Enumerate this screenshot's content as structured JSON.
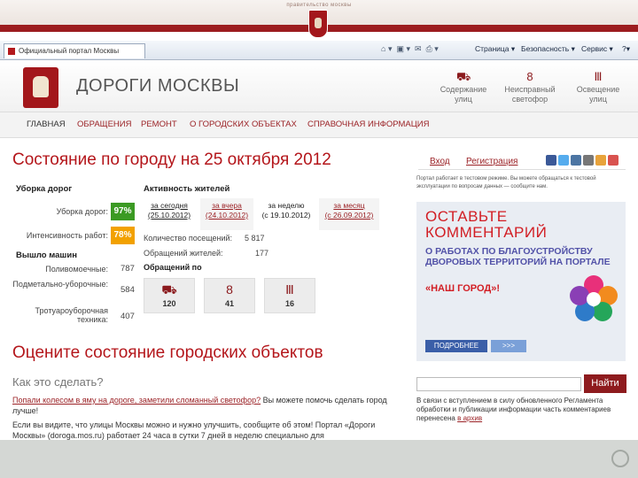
{
  "gov_banner": {
    "label": "правительство москвы"
  },
  "browser": {
    "tab_title": "Официальный портал Москвы",
    "menu": [
      "Страница ▾",
      "Безопасность ▾",
      "Сервис ▾",
      "?▾"
    ],
    "toolbar_icons": [
      "home-icon",
      "feeds-icon",
      "mail-icon",
      "print-icon"
    ]
  },
  "site": {
    "title": "ДОРОГИ МОСКВЫ",
    "header_links": [
      {
        "line1": "Содержание",
        "line2": "улиц",
        "icon": "truck-icon"
      },
      {
        "line1": "Неисправный",
        "line2": "светофор",
        "icon": "traffic-light-icon"
      },
      {
        "line1": "Освещение",
        "line2": "улиц",
        "icon": "street-light-icon"
      }
    ]
  },
  "nav": [
    "ГЛАВНАЯ",
    "ОБРАЩЕНИЯ",
    "РЕМОНТ",
    "О ГОРОДСКИХ ОБЪЕКТАХ",
    "СПРАВОЧНАЯ ИНФОРМАЦИЯ"
  ],
  "status": {
    "title": "Состояние по городу на 25 октября 2012",
    "cleaning": {
      "heading": "Уборка дорог",
      "rows": [
        {
          "label": "Уборка дорог:",
          "value": "97%",
          "color": "#3b9a23"
        },
        {
          "label": "Интенсивность работ:",
          "value": "78%",
          "color": "#f2a100"
        }
      ]
    },
    "machines": {
      "heading": "Вышло машин",
      "rows": [
        {
          "label": "Поливомоечные:",
          "value": "787"
        },
        {
          "label": "Подметально-уборочные:",
          "value": "584"
        },
        {
          "label": "Тротуароуборочная техника:",
          "value": "407"
        }
      ]
    },
    "activity": {
      "heading": "Активность жителей",
      "tabs": [
        {
          "line1": "за сегодня",
          "line2": "(25.10.2012)"
        },
        {
          "line1": "за вчера",
          "line2": "(24.10.2012)"
        },
        {
          "line1": "за неделю",
          "line2": "(с 19.10.2012)"
        },
        {
          "line1": "за месяц",
          "line2": "(с 26.09.2012)"
        }
      ],
      "visits_label": "Количество посещений:",
      "visits_value": "5 817",
      "appeals_label": "Обращений жителей:",
      "appeals_value": "177",
      "by_label": "Обращений по",
      "counts": [
        {
          "icon": "truck-icon",
          "value": "120"
        },
        {
          "icon": "traffic-light-icon",
          "value": "41"
        },
        {
          "icon": "street-light-icon",
          "value": "16"
        }
      ]
    }
  },
  "rate": {
    "title": "Оцените состояние городских объектов",
    "howto": "Как это сделать?",
    "p1_link": "Попали колесом в яму на дороге, заметили сломанный светофор?",
    "p1_rest": " Вы можете помочь сделать город лучше!",
    "p2": "Если вы видите, что улицы Москвы можно и нужно улучшить, сообщите об этом! Портал «Дороги Москвы» (doroga.mos.ru) работает 24 часа в сутки 7 дней в неделю специально для"
  },
  "sidebar": {
    "login": "Вход",
    "register": "Регистрация",
    "small_text": "Портал работает в тестовом режиме. Вы можете обращаться к тестовой эксплуатации по вопросам данных — сообщите нам.",
    "promo": {
      "title1": "ОСТАВЬТЕ",
      "title2": "КОММЕНТАРИЙ",
      "body": "О РАБОТАХ ПО БЛАГОУСТРОЙСТВУ ДВОРОВЫХ ТЕРРИТОРИЙ НА ПОРТАЛЕ",
      "portal": "«НАШ ГОРОД»!",
      "more": "ПОДРОБНЕЕ",
      "arrows": ">>>"
    },
    "search_placeholder": "",
    "search_button": "Найти",
    "notice_text": "В связи с вступлением в силу обновленного Регламента обработки и публикации информации часть комментариев перенесена ",
    "notice_link": "в архив"
  },
  "colors": {
    "brand_red": "#b4161b",
    "dark_red": "#8e1b1e",
    "link": "#9b2226",
    "good": "#3b9a23",
    "warn": "#f2a100"
  }
}
